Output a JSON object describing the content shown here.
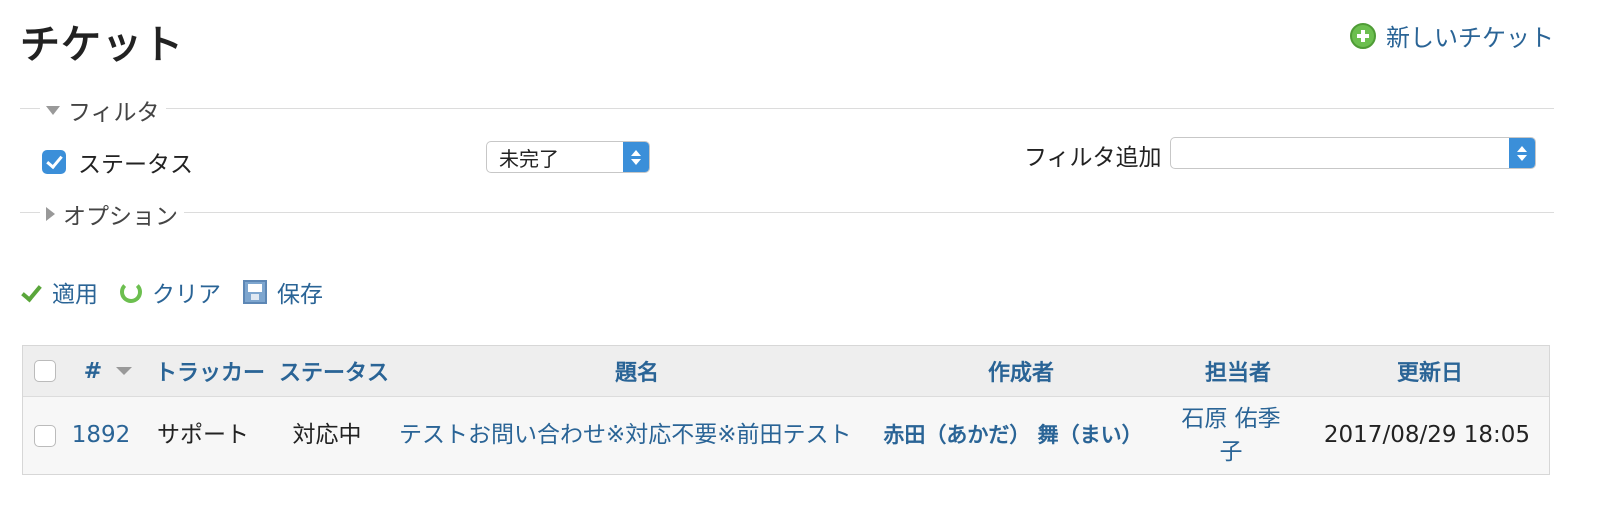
{
  "header": {
    "title": "チケット",
    "new_ticket_label": "新しいチケット"
  },
  "filters": {
    "legend": "フィルタ",
    "status_label": "ステータス",
    "status_value": "未完了",
    "add_filter_label": "フィルタ追加",
    "add_filter_value": ""
  },
  "options": {
    "legend": "オプション"
  },
  "actions": {
    "apply": "適用",
    "clear": "クリア",
    "save": "保存"
  },
  "table": {
    "columns": {
      "id": "#",
      "tracker": "トラッカー",
      "status": "ステータス",
      "subject": "題名",
      "author": "作成者",
      "assignee": "担当者",
      "updated": "更新日"
    },
    "rows": [
      {
        "id": "1892",
        "tracker": "サポート",
        "status": "対応中",
        "subject": "テストお問い合わせ※対応不要※前田テスト",
        "author": "赤田（あかだ） 舞（まい）",
        "assignee": "石原 佑季子",
        "updated": "2017/08/29 18:05"
      }
    ]
  },
  "colors": {
    "link": "#2a6496",
    "accent": "#3b8fd9",
    "green_icon": "#6cbf4f"
  }
}
